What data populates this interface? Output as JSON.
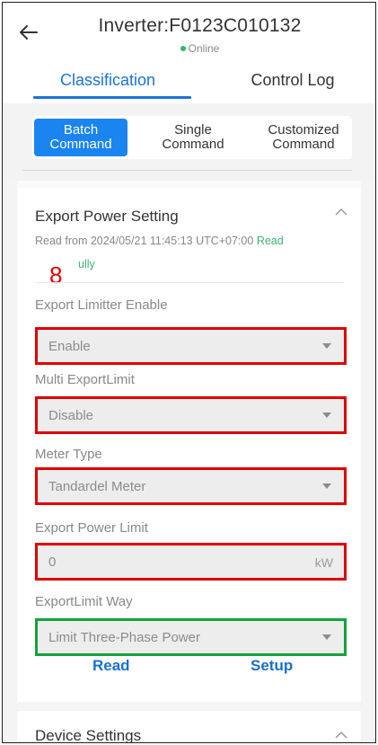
{
  "header": {
    "title": "Inverter:F0123C010132",
    "status": "Online"
  },
  "tabs": [
    {
      "label": "Classification",
      "active": true
    },
    {
      "label": "Control Log",
      "active": false
    }
  ],
  "commands": [
    {
      "label": "Batch\nCommand",
      "active": true
    },
    {
      "label": "Single\nCommand",
      "active": false
    },
    {
      "label": "Customized\nCommand",
      "active": false
    }
  ],
  "section": {
    "title": "Export Power Setting",
    "read_info": "Read from 2024/05/21 11:45:13 UTC+07:00",
    "read_status_part1": "Read",
    "read_status_part2": "ully",
    "annotation_number": "8",
    "fields": [
      {
        "label": "Export Limitter Enable",
        "value": "Enable"
      },
      {
        "label": "Multi ExportLimit",
        "value": "Disable"
      },
      {
        "label": "Meter Type",
        "value": "Tandardel Meter"
      },
      {
        "label": "Export Power Limit",
        "value": "0",
        "unit": "kW"
      },
      {
        "label": "ExportLimit Way",
        "value": "Limit Three-Phase Power"
      }
    ],
    "actions": {
      "read": "Read",
      "setup": "Setup"
    }
  },
  "section2": {
    "title": "Device Settings"
  },
  "colors": {
    "accent": "#1a73d9",
    "highlight_red": "#e10000",
    "highlight_green": "#12a33a",
    "online": "#2fb86a"
  }
}
